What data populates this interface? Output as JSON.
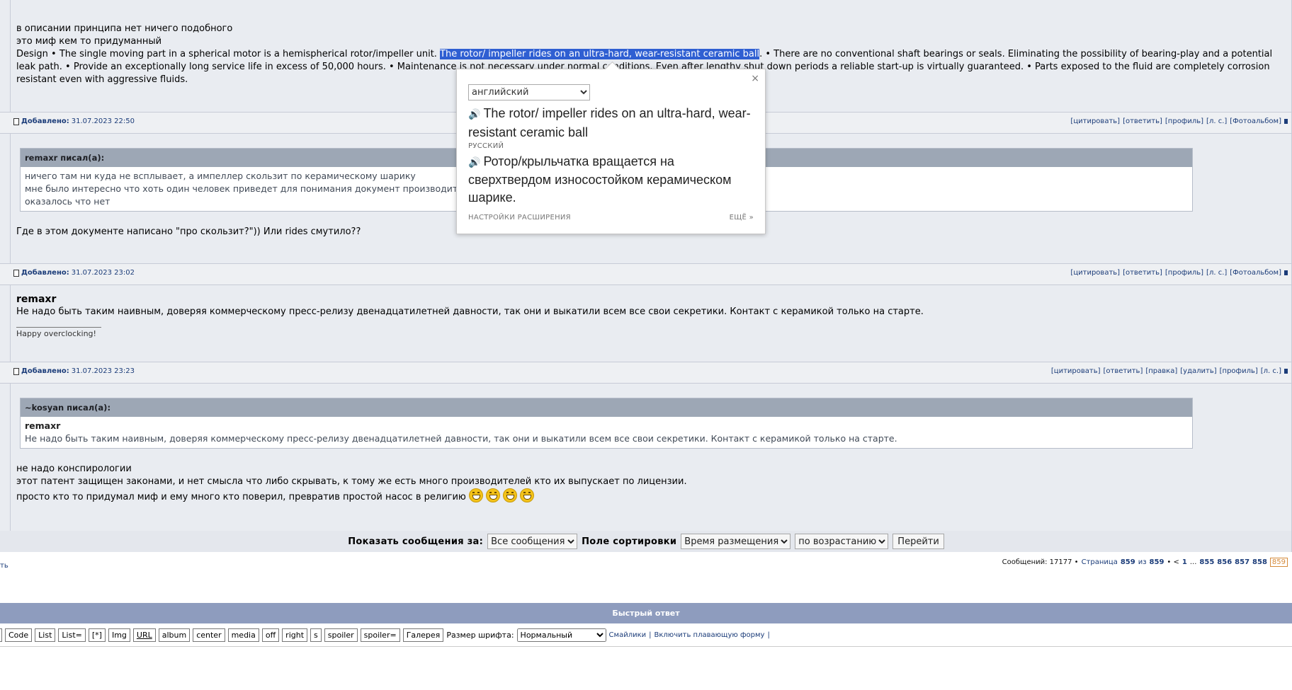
{
  "post0": {
    "lines": [
      "в описании принципа нет ничего подобного",
      "это миф кем то придуманный"
    ],
    "design_before": "Design • The single moving part in a spherical motor is a hemispherical rotor/impeller unit. ",
    "design_selected": "The rotor/ impeller rides on an ultra-hard, wear-resistant ceramic ball",
    "design_after": ". • There are no conventional shaft bearings or seals. Eliminating the possibility of bearing-play and a potential leak path. • Provide an exceptionally long service life in excess of 50,000 hours. • Maintenance is not necessary under normal conditions. Even after lengthy shut down periods a reliable start-up is virtually guaranteed. • Parts exposed to the fluid are completely corrosion resistant even with aggressive fluids."
  },
  "actions": {
    "quote": "[цитировать]",
    "reply": "[ответить]",
    "profile": "[профиль]",
    "pm": "[л. с.]",
    "album": "[Фотоальбом]",
    "edit": "[правка]",
    "delete": "[удалить]"
  },
  "post1": {
    "added_label": "Добавлено:",
    "date": "31.07.2023 22:50",
    "quote_author": "remaxr писал(а):",
    "quote_lines": [
      "ничего там ни куда не всплывает, а импеллер скользит по керамическому шарику",
      "мне было интересно что хоть один человек приведет для понимания документ производителя",
      "оказалось что нет"
    ],
    "text": "Где в этом документе написано \"про скользит?\")) Или rides смутило??"
  },
  "post2": {
    "added_label": "Добавлено:",
    "date": "31.07.2023 23:02",
    "author": "remaxr",
    "text": "Не надо быть таким наивным, доверяя коммерческому пресс-релизу двенадцатилетней давности, так они и выкатили всем все свои секретики. Контакт с керамикой только на старте.",
    "signature": "Happy overclocking!"
  },
  "post3": {
    "added_label": "Добавлено:",
    "date": "31.07.2023 23:23",
    "quote_author": "~kosyan писал(а):",
    "quote_name": "remaxr",
    "quote_text": "Не надо быть таким наивным, доверяя коммерческому пресс-релизу двенадцатилетней давности, так они и выкатили всем все свои секретики. Контакт с керамикой только на старте.",
    "lines": [
      "не надо конспирологии",
      "этот патент защищен законами, и нет смысла что либо скрывать, к тому же есть много производителей кто их выпускает по лицензии.",
      "просто кто то придумал миф и ему много кто поверил, превратив простой насос в религию"
    ],
    "emoji_count": 4
  },
  "popup": {
    "source_lang": "английский",
    "source_text": "The rotor/ impeller rides on an ultra-hard, wear-resistant ceramic ball",
    "target_lang": "РУССКИЙ",
    "target_text": "Ротор/крыльчатка вращается на сверхтвердом износостойком керамическом шарике.",
    "settings": "НАСТРОЙКИ РАСШИРЕНИЯ",
    "more": "ЕЩЁ »",
    "close": "×"
  },
  "controls": {
    "show_label": "Показать сообщения за:",
    "show_value": "Все сообщения",
    "sort_label": "Поле сортировки",
    "sort_value": "Время размещения",
    "order_value": "по возрастанию",
    "go": "Перейти"
  },
  "pager": {
    "messages": "Сообщений: 17177 •",
    "page_word": "Страница",
    "current": "859",
    "of_word": "из",
    "total": "859",
    "sep": "• <",
    "first": "1",
    "dots": "...",
    "p855": "855",
    "p856": "856",
    "p857": "857",
    "p858": "858",
    "p859": "859"
  },
  "left_link": "ть",
  "quick_reply": {
    "title": "Быстрый ответ",
    "buttons": [
      "Code",
      "List",
      "List=",
      "[*]",
      "Img",
      "URL",
      "album",
      "center",
      "media",
      "off",
      "right",
      "s",
      "spoiler",
      "spoiler=",
      "Галерея"
    ],
    "font_size_label": "Размер шрифта:",
    "font_size_value": "Нормальный",
    "smilies": "Смайлики",
    "sep1": "|",
    "floating": "Включить плавающую форму",
    "sep2": "|"
  }
}
